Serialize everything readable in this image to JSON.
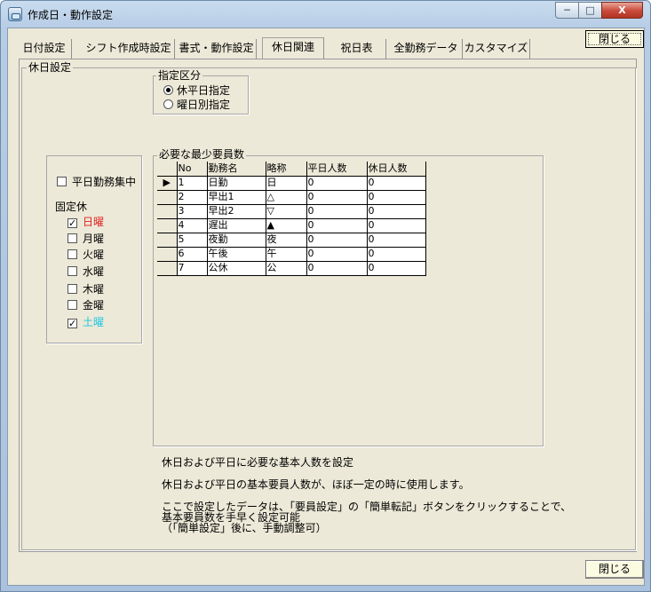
{
  "window": {
    "title": "作成日・動作設定",
    "caption_min": "─",
    "caption_max": "□",
    "caption_close": "X"
  },
  "tabs": [
    {
      "label": "日付設定",
      "active": false
    },
    {
      "label": "シフト作成時設定",
      "active": false
    },
    {
      "label": "書式・動作設定",
      "active": false
    },
    {
      "label": "休日関連",
      "active": true
    },
    {
      "label": "祝日表",
      "active": false
    },
    {
      "label": "全勤務データ",
      "active": false
    },
    {
      "label": "カスタマイズ",
      "active": false
    }
  ],
  "buttons": {
    "close_top": "閉じる",
    "close_bottom": "閉じる"
  },
  "holiday_settings": {
    "group_label": "休日設定",
    "designation": {
      "group_label": "指定区分",
      "options": [
        {
          "label": "休平日指定",
          "selected": true
        },
        {
          "label": "曜日別指定",
          "selected": false
        }
      ]
    },
    "weekday_focus": {
      "label": "平日勤務集中",
      "checked": false
    },
    "fixed_holidays": {
      "label": "固定休",
      "days": [
        {
          "label": "日曜",
          "checked": true,
          "color": "#e02020"
        },
        {
          "label": "月曜",
          "checked": false,
          "color": "#000000"
        },
        {
          "label": "火曜",
          "checked": false,
          "color": "#000000"
        },
        {
          "label": "水曜",
          "checked": false,
          "color": "#000000"
        },
        {
          "label": "木曜",
          "checked": false,
          "color": "#000000"
        },
        {
          "label": "金曜",
          "checked": false,
          "color": "#000000"
        },
        {
          "label": "土曜",
          "checked": true,
          "color": "#1ec8e0"
        }
      ]
    },
    "staff_table": {
      "group_label": "必要な最少要員数",
      "columns": [
        "No",
        "勤務名",
        "略称",
        "平日人数",
        "休日人数"
      ],
      "current_row_marker": "▶",
      "rows": [
        [
          "1",
          "日勤",
          "日",
          "0",
          "0"
        ],
        [
          "2",
          "早出1",
          "△",
          "0",
          "0"
        ],
        [
          "3",
          "早出2",
          "▽",
          "0",
          "0"
        ],
        [
          "4",
          "遅出",
          "▲",
          "0",
          "0"
        ],
        [
          "5",
          "夜勤",
          "夜",
          "0",
          "0"
        ],
        [
          "6",
          "午後",
          "午",
          "0",
          "0"
        ],
        [
          "7",
          "公休",
          "公",
          "0",
          "0"
        ]
      ]
    },
    "notes": {
      "line1": "休日および平日に必要な基本人数を設定",
      "line2": "休日および平日の基本要員人数が、ほぼ一定の時に使用します。",
      "line3": "ここで設定したデータは、「要員設定」の「簡単転記」ボタンをクリックすることで、",
      "line4": "基本要員数を手早く設定可能",
      "line5": "（「簡単設定」後に、手動調整可）"
    }
  }
}
